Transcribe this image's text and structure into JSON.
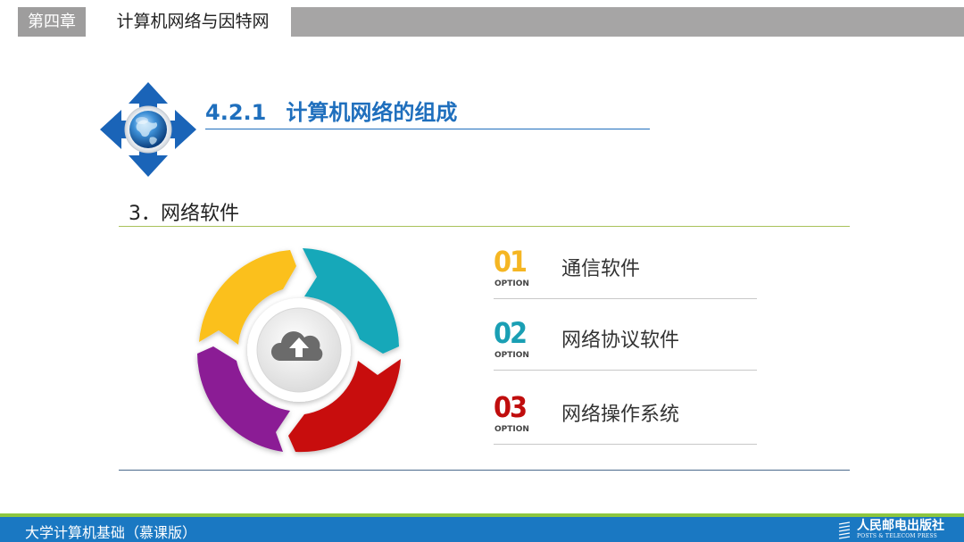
{
  "header": {
    "chapter_tag": "第四章",
    "chapter_title": "计算机网络与因特网"
  },
  "section": {
    "number": "4.2.1",
    "title": "计算机网络的组成"
  },
  "subheading": "3．网络软件",
  "options": [
    {
      "number": "01",
      "tag": "OPTION",
      "label": "通信软件",
      "color": "#f5b623"
    },
    {
      "number": "02",
      "tag": "OPTION",
      "label": "网络协议软件",
      "color": "#1a9fb4"
    },
    {
      "number": "03",
      "tag": "OPTION",
      "label": "网络操作系统",
      "color": "#c00d0d"
    }
  ],
  "cycle": {
    "center_icon": "cloud-upload-icon",
    "segment_colors": [
      "#fbc01a",
      "#13a8b9",
      "#c80d0d",
      "#8b1c95"
    ]
  },
  "badge_icon": "globe-arrows-icon",
  "footer": {
    "title": "大学计算机基础（慕课版）",
    "publisher_cn": "人民邮电出版社",
    "publisher_en": "POSTS & TELECOM PRESS"
  },
  "colors": {
    "accent_blue": "#1f6fbd",
    "footer_blue": "#1a78c2",
    "footer_green": "#8cc63f",
    "header_gray": "#a6a5a5"
  }
}
